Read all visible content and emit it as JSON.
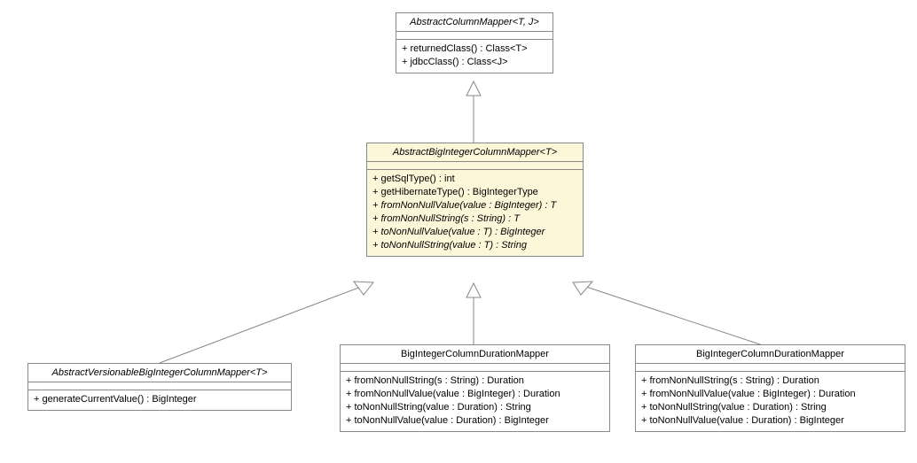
{
  "classes": {
    "top": {
      "name": "AbstractColumnMapper<T, J>",
      "methods": [
        "+ returnedClass() : Class<T>",
        "+ jdbcClass() : Class<J>"
      ]
    },
    "middle": {
      "name": "AbstractBigIntegerColumnMapper<T>",
      "methods": [
        "+ getSqlType() : int",
        "+ getHibernateType() : BigIntegerType",
        "+ fromNonNullValue(value : BigInteger) : T",
        "+ fromNonNullString(s : String) : T",
        "+ toNonNullValue(value : T) : BigInteger",
        "+ toNonNullString(value : T) : String"
      ]
    },
    "bottomLeft": {
      "name": "AbstractVersionableBigIntegerColumnMapper<T>",
      "methods": [
        "+ generateCurrentValue() : BigInteger"
      ]
    },
    "bottomMid": {
      "name": "BigIntegerColumnDurationMapper",
      "methods": [
        "+ fromNonNullString(s : String) : Duration",
        "+ fromNonNullValue(value : BigInteger) : Duration",
        "+ toNonNullString(value : Duration) : String",
        "+ toNonNullValue(value : Duration) : BigInteger"
      ]
    },
    "bottomRight": {
      "name": "BigIntegerColumnDurationMapper",
      "methods": [
        "+ fromNonNullString(s : String) : Duration",
        "+ fromNonNullValue(value : BigInteger) : Duration",
        "+ toNonNullString(value : Duration) : String",
        "+ toNonNullValue(value : Duration) : BigInteger"
      ]
    }
  }
}
